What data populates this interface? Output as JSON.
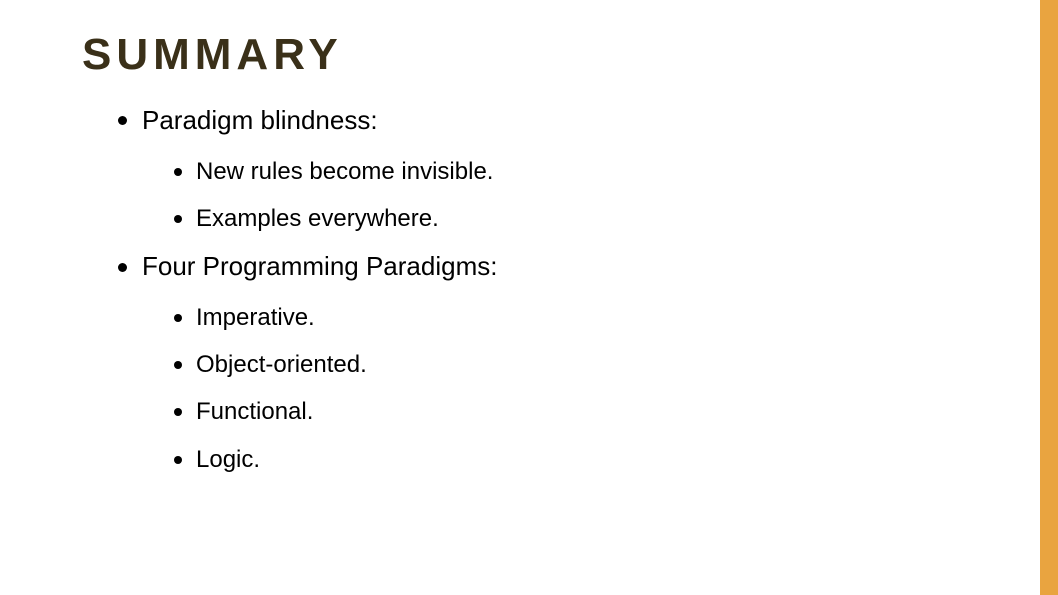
{
  "title": "SUMMARY",
  "items": [
    {
      "text": "Paradigm blindness:",
      "children": [
        {
          "text": "New rules become invisible."
        },
        {
          "text": "Examples everywhere."
        }
      ]
    },
    {
      "text": "Four Programming Paradigms:",
      "children": [
        {
          "text": "Imperative."
        },
        {
          "text": "Object-oriented."
        },
        {
          "text": "Functional."
        },
        {
          "text": "Logic."
        }
      ]
    }
  ]
}
